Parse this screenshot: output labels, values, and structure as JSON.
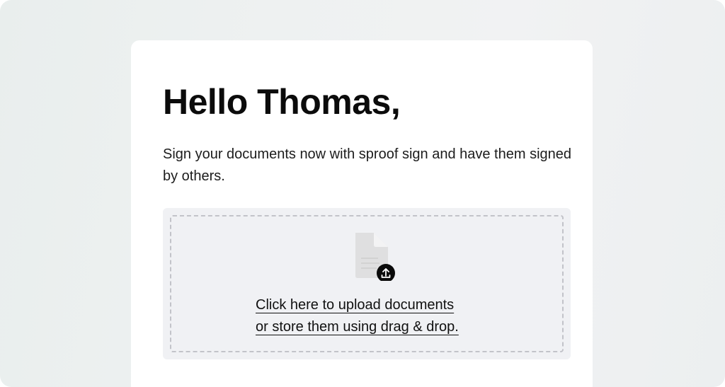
{
  "greeting": {
    "title": "Hello Thomas,"
  },
  "intro": {
    "text": "Sign your documents now with sproof sign and have them signed by others."
  },
  "upload": {
    "document_icon": "document-icon",
    "upload_badge_icon": "upload-arrow-icon",
    "link_line1": "Click here to upload documents",
    "link_line2": "or store them using drag & drop."
  },
  "colors": {
    "background": "#eef1f1",
    "card": "#ffffff",
    "dropzone": "#f0f1f4",
    "dashed_border": "#c2c3c9",
    "text": "#0b0b0b"
  }
}
